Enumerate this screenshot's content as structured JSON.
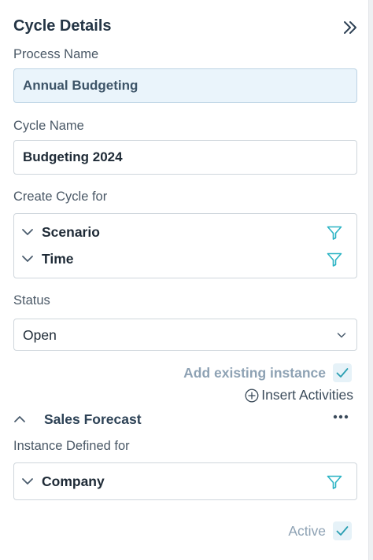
{
  "panel": {
    "title": "Cycle Details",
    "collapse_icon": "double-chevron-right-icon"
  },
  "process": {
    "label": "Process Name",
    "value": "Annual Budgeting"
  },
  "cycle": {
    "label": "Cycle Name",
    "value": "Budgeting 2024"
  },
  "create_for": {
    "label": "Create Cycle for",
    "dimensions": [
      {
        "label": "Scenario",
        "icon": "filter-icon"
      },
      {
        "label": "Time",
        "icon": "filter-icon"
      }
    ]
  },
  "status": {
    "label": "Status",
    "value": "Open"
  },
  "existing_instance": {
    "label": "Add existing instance",
    "checked": true
  },
  "insert_activities": {
    "label": "Insert Activities",
    "icon": "plus-circle-icon"
  },
  "section": {
    "title": "Sales Forecast",
    "instance_label": "Instance Defined for",
    "dimensions": [
      {
        "label": "Company",
        "icon": "filter-icon"
      }
    ],
    "active_label": "Active",
    "active_checked": true
  },
  "colors": {
    "accent": "#2ab3c4",
    "muted_label": "#8ea2b4",
    "title": "#243545"
  }
}
